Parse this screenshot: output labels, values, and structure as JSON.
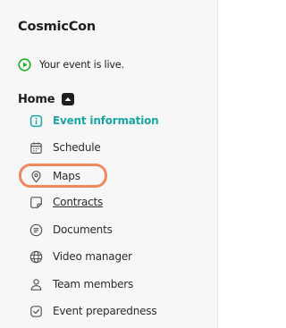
{
  "app": {
    "title": "CosmicCon"
  },
  "status": {
    "text": "Your event is live.",
    "icon": "play-circle-icon",
    "color": "#19b11f"
  },
  "section": {
    "title": "Home",
    "collapse_icon": "chevron-up-icon"
  },
  "accent_color": "#1aa6a3",
  "highlight_color": "#ef8a5d",
  "nav": {
    "items": [
      {
        "label": "Event information",
        "icon": "info-icon",
        "active": true
      },
      {
        "label": "Schedule",
        "icon": "calendar-icon"
      },
      {
        "label": "Maps",
        "icon": "map-pin-icon",
        "highlighted": true
      },
      {
        "label": "Contracts",
        "icon": "contract-icon",
        "underlined": true
      },
      {
        "label": "Documents",
        "icon": "document-icon"
      },
      {
        "label": "Video manager",
        "icon": "globe-icon"
      },
      {
        "label": "Team members",
        "icon": "team-icon"
      },
      {
        "label": "Event preparedness",
        "icon": "checklist-icon"
      }
    ]
  }
}
